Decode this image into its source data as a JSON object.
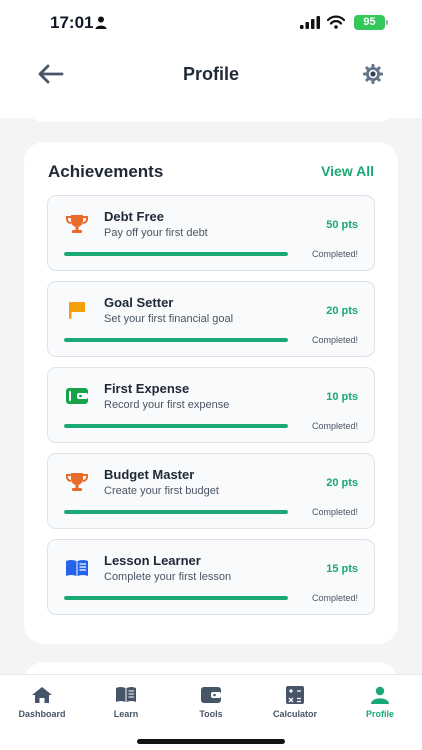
{
  "status_bar": {
    "time": "17:01",
    "battery": "95"
  },
  "header": {
    "title": "Profile",
    "back_icon": "arrow-left-icon",
    "settings_icon": "gear-icon"
  },
  "achievements": {
    "title": "Achievements",
    "view_all": "View All",
    "items": [
      {
        "name": "Debt Free",
        "description": "Pay off your first debt",
        "points": "50 pts",
        "status": "Completed!",
        "progress": 1.0,
        "icon": "trophy-icon",
        "icon_color": "#ea6a2a"
      },
      {
        "name": "Goal Setter",
        "description": "Set your first financial goal",
        "points": "20 pts",
        "status": "Completed!",
        "progress": 1.0,
        "icon": "flag-icon",
        "icon_color": "#f59e0b"
      },
      {
        "name": "First Expense",
        "description": "Record your first expense",
        "points": "10 pts",
        "status": "Completed!",
        "progress": 1.0,
        "icon": "wallet-icon",
        "icon_color": "#16a34a"
      },
      {
        "name": "Budget Master",
        "description": "Create your first budget",
        "points": "20 pts",
        "status": "Completed!",
        "progress": 1.0,
        "icon": "trophy-icon",
        "icon_color": "#ea6a2a"
      },
      {
        "name": "Lesson Learner",
        "description": "Complete your first lesson",
        "points": "15 pts",
        "status": "Completed!",
        "progress": 1.0,
        "icon": "book-icon",
        "icon_color": "#2563eb"
      }
    ]
  },
  "tabs": [
    {
      "label": "Dashboard",
      "icon": "home-icon",
      "active": false
    },
    {
      "label": "Learn",
      "icon": "book-open-icon",
      "active": false
    },
    {
      "label": "Tools",
      "icon": "wallet-icon",
      "active": false
    },
    {
      "label": "Calculator",
      "icon": "calculator-icon",
      "active": false
    },
    {
      "label": "Profile",
      "icon": "user-icon",
      "active": true
    }
  ],
  "colors": {
    "accent": "#1aa874",
    "tab_inactive": "#475569",
    "background": "#f3f4f6"
  }
}
